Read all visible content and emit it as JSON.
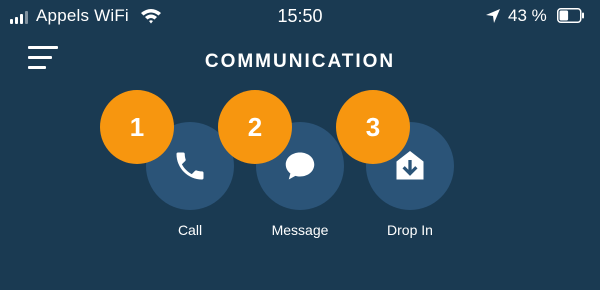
{
  "status_bar": {
    "carrier": "Appels WiFi",
    "time": "15:50",
    "battery_percent": "43 %",
    "battery_level": 0.43,
    "icons": [
      "signal-icon",
      "wifi-icon",
      "location-arrow-icon",
      "battery-icon"
    ]
  },
  "header": {
    "menu_icon": "hamburger-menu-icon",
    "title": "COMMUNICATION"
  },
  "actions": [
    {
      "label": "Call",
      "icon": "phone-icon",
      "badge": "1"
    },
    {
      "label": "Message",
      "icon": "speech-bubble-icon",
      "badge": "2"
    },
    {
      "label": "Drop In",
      "icon": "drop-in-icon",
      "badge": "3"
    }
  ],
  "colors": {
    "background": "#1a3a52",
    "button": "#2b5478",
    "badge": "#f7960f",
    "text": "#ffffff"
  }
}
